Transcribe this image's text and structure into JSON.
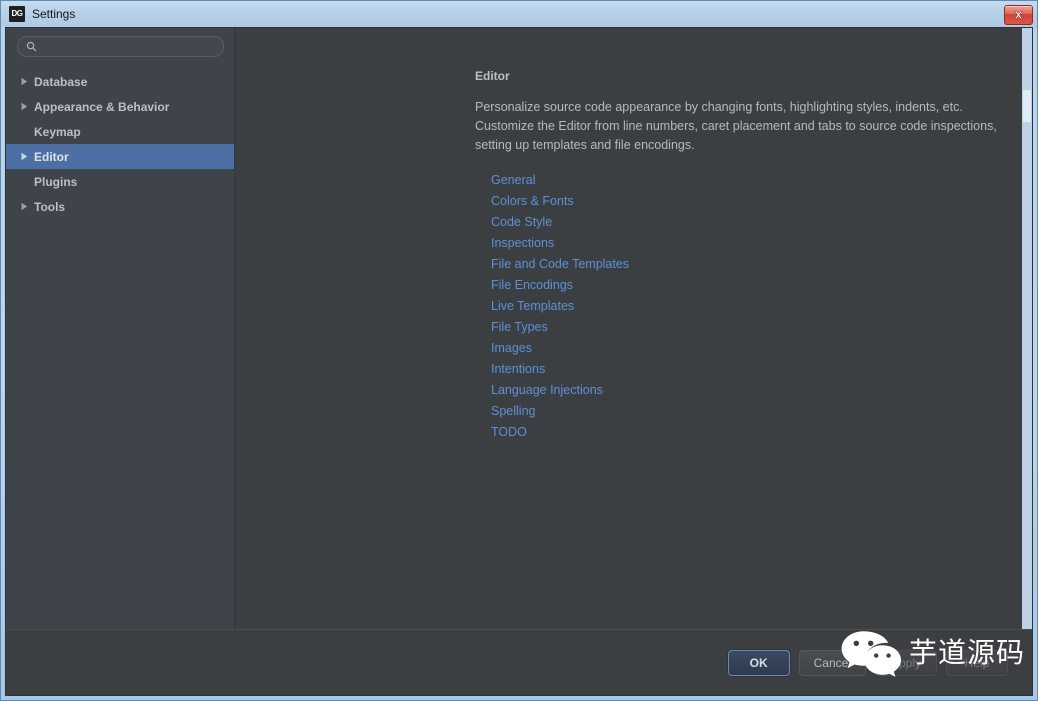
{
  "window": {
    "title": "Settings",
    "app_icon": "DG",
    "app_icon_name": "datagrip-icon",
    "close_icon": "close-icon"
  },
  "sidebar": {
    "search": {
      "value": "",
      "placeholder": "",
      "icon": "search-icon"
    },
    "items": [
      {
        "label": "Database",
        "expandable": true,
        "selected": false
      },
      {
        "label": "Appearance & Behavior",
        "expandable": true,
        "selected": false
      },
      {
        "label": "Keymap",
        "expandable": false,
        "selected": false
      },
      {
        "label": "Editor",
        "expandable": true,
        "selected": true
      },
      {
        "label": "Plugins",
        "expandable": false,
        "selected": false
      },
      {
        "label": "Tools",
        "expandable": true,
        "selected": false
      }
    ]
  },
  "content": {
    "title": "Editor",
    "description": "Personalize source code appearance by changing fonts, highlighting styles, indents, etc. Customize the Editor from line numbers, caret placement and tabs to source code inspections, setting up templates and file encodings.",
    "links": [
      "General",
      "Colors & Fonts",
      "Code Style",
      "Inspections",
      "File and Code Templates",
      "File Encodings",
      "Live Templates",
      "File Types",
      "Images",
      "Intentions",
      "Language Injections",
      "Spelling",
      "TODO"
    ]
  },
  "footer": {
    "buttons": [
      {
        "label": "OK",
        "style": "default"
      },
      {
        "label": "Cancel",
        "style": "normal"
      },
      {
        "label": "Apply",
        "style": "disabled"
      },
      {
        "label": "Help",
        "style": "disabled"
      }
    ]
  },
  "watermark": {
    "text": "芋道源码",
    "logo": "wechat-icon"
  },
  "colors": {
    "accent_selection": "#4c6fa5",
    "link": "#5e90d6",
    "dialog_bg": "#3c3f41",
    "sidebar_bg": "#3f434a",
    "titlebar_bg": "#b7d0e8",
    "close_button": "#cf4436"
  }
}
